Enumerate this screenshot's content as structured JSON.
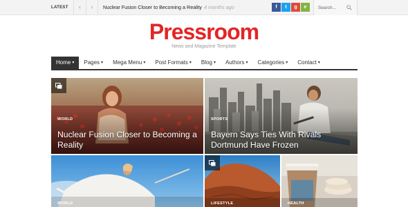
{
  "topbar": {
    "latest_label": "LATEST",
    "ticker_title": "Nuclear Fusion Closer to Becoming a Reality",
    "ticker_time": "4 months ago",
    "search_placeholder": "Search...",
    "social": [
      {
        "icon": "facebook-icon",
        "glyph": "f",
        "color": "#3b5998"
      },
      {
        "icon": "twitter-icon",
        "glyph": "t",
        "color": "#1da1f2"
      },
      {
        "icon": "google-plus-icon",
        "glyph": "g",
        "color": "#dd4b39"
      },
      {
        "icon": "envato-icon",
        "glyph": "e",
        "color": "#82b541"
      }
    ]
  },
  "header": {
    "logo": "Pressroom",
    "tagline": "News and Magazine Template",
    "brand_color": "#e32526"
  },
  "nav": {
    "items": [
      {
        "label": "Home",
        "active": true
      },
      {
        "label": "Pages"
      },
      {
        "label": "Mega Menu"
      },
      {
        "label": "Post Formats"
      },
      {
        "label": "Blog"
      },
      {
        "label": "Authors"
      },
      {
        "label": "Categories"
      },
      {
        "label": "Contact"
      }
    ],
    "caret": "▾"
  },
  "tiles": [
    {
      "category": "WORLD",
      "title": "Nuclear Fusion Closer to Becoming a Reality",
      "icon": "gallery-icon"
    },
    {
      "category": "SPORTS",
      "title": "Bayern Says Ties With Rivals Dortmund Have Frozen"
    },
    {
      "category": "WORLD"
    },
    {
      "category": "LIFESTYLE",
      "icon": "gallery-icon"
    },
    {
      "category": "HEALTH"
    }
  ]
}
